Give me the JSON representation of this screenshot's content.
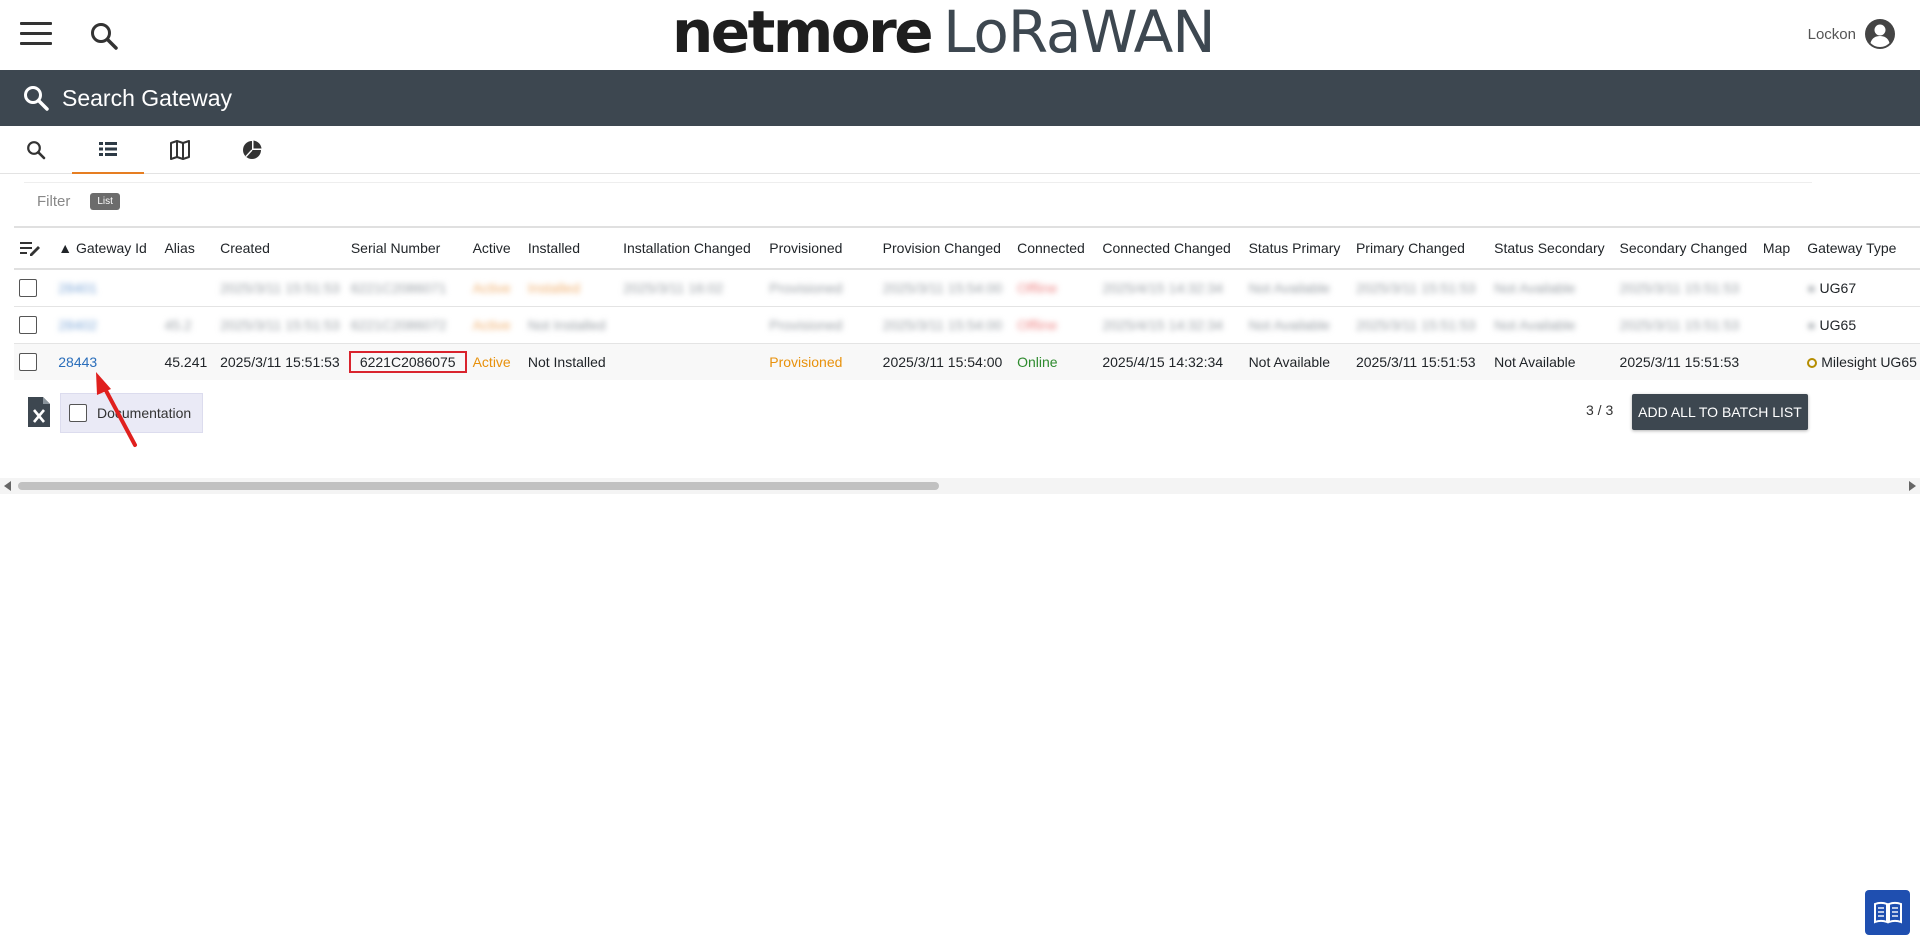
{
  "header": {
    "brand_primary": "netmore",
    "brand_secondary": "LoRaWAN",
    "user_name": "Lockon"
  },
  "search_band": {
    "title": "Search Gateway"
  },
  "tabs": [
    {
      "icon": "search-icon",
      "active": false
    },
    {
      "icon": "list-icon",
      "active": true
    },
    {
      "icon": "map-icon",
      "active": false
    },
    {
      "icon": "pie-chart-icon",
      "active": false
    }
  ],
  "filter": {
    "label": "Filter",
    "chip": "List"
  },
  "table": {
    "columns": [
      "",
      "▲ Gateway Id",
      "Alias",
      "Created",
      "Serial Number",
      "Active",
      "Installed",
      "Installation Changed",
      "Provisioned",
      "Provision Changed",
      "Connected",
      "Connected Changed",
      "Status Primary",
      "Primary Changed",
      "Status Secondary",
      "Secondary Changed",
      "Map",
      "Gateway Type"
    ],
    "rows": [
      {
        "blurred": true,
        "cells": [
          "",
          "28401",
          "",
          "2025/3/11 15:51:53",
          "6221C2086071",
          "Active",
          "Installed",
          "2025/3/11 16:02",
          "Provisioned",
          "2025/3/11 15:54:00",
          "Offline",
          "2025/4/15 14:32:34",
          "Not Available",
          "2025/3/11 15:51:53",
          "Not Available",
          "2025/3/11 15:51:53",
          "",
          "Milesight UG67"
        ],
        "visible_type": "UG67"
      },
      {
        "blurred": true,
        "cells": [
          "",
          "28402",
          "45.2",
          "2025/3/11 15:51:53",
          "6221C2086072",
          "Active",
          "Not Installed",
          "",
          "Provisioned",
          "2025/3/11 15:54:00",
          "Offline",
          "2025/4/15 14:32:34",
          "Not Available",
          "2025/3/11 15:51:53",
          "Not Available",
          "2025/3/11 15:51:53",
          "",
          "Milesight UG65"
        ],
        "visible_type": "UG65"
      },
      {
        "blurred": false,
        "cells": [
          "",
          "28443",
          "45.241",
          "2025/3/11 15:51:53",
          "6221C2086075",
          "Active",
          "Not Installed",
          "",
          "Provisioned",
          "2025/3/11 15:54:00",
          "Online",
          "2025/4/15 14:32:34",
          "Not Available",
          "2025/3/11 15:51:53",
          "Not Available",
          "2025/3/11 15:51:53",
          "",
          "Milesight UG65"
        ]
      }
    ]
  },
  "footer": {
    "documentation_label": "Documentation",
    "count": "3 / 3",
    "batch_button": "ADD ALL TO BATCH LIST"
  },
  "colors": {
    "header_band": "#3d4750",
    "tab_active": "#e67e22",
    "link": "#2a6ebb",
    "warning": "#e8910c",
    "online": "#2e8b2e",
    "highlight": "#d9232d",
    "book_button": "#1f4fb0"
  }
}
